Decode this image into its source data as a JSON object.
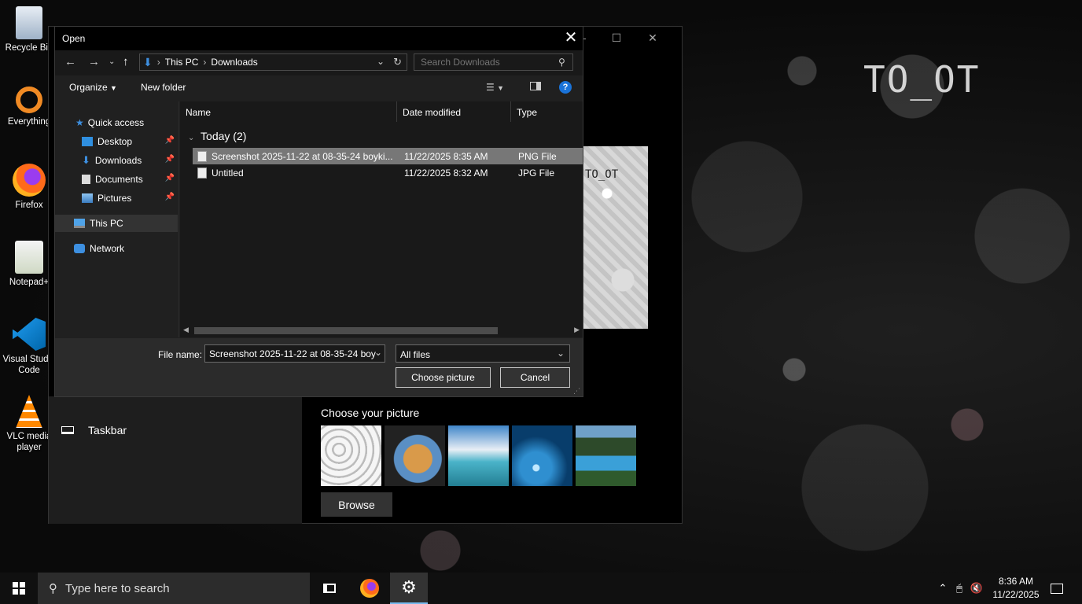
{
  "desktop": {
    "icons": [
      {
        "label": "Recycle Bin",
        "icon": "recycle-bin-icon"
      },
      {
        "label": "Everything",
        "icon": "everything-icon"
      },
      {
        "label": "Firefox",
        "icon": "firefox-icon"
      },
      {
        "label": "Notepad+",
        "icon": "notepad-plus-icon"
      },
      {
        "label": "Visual Studio Code",
        "icon": "vscode-icon"
      },
      {
        "label": "VLC media player",
        "icon": "vlc-icon"
      }
    ],
    "wallpaper_text": "TO_OT"
  },
  "settings_window": {
    "nav_taskbar": "Taskbar",
    "choose_your_picture": "Choose your picture",
    "browse_label": "Browse"
  },
  "dialog": {
    "title": "Open",
    "address": {
      "root": "This PC",
      "current": "Downloads"
    },
    "search_placeholder": "Search Downloads",
    "toolbar": {
      "organize": "Organize",
      "new_folder": "New folder"
    },
    "nav": {
      "quick_access": "Quick access",
      "desktop": "Desktop",
      "downloads": "Downloads",
      "documents": "Documents",
      "pictures": "Pictures",
      "this_pc": "This PC",
      "network": "Network"
    },
    "columns": {
      "name": "Name",
      "date": "Date modified",
      "type": "Type"
    },
    "group": "Today (2)",
    "files": [
      {
        "name": "Screenshot 2025-11-22 at 08-35-24 boyki...",
        "date": "11/22/2025 8:35 AM",
        "type": "PNG File"
      },
      {
        "name": "Untitled",
        "date": "11/22/2025 8:32 AM",
        "type": "JPG File"
      }
    ],
    "file_name_label": "File name:",
    "file_name_value": "Screenshot 2025-11-22 at 08-35-24 boy",
    "file_type": "All files",
    "choose_button": "Choose picture",
    "cancel_button": "Cancel"
  },
  "taskbar": {
    "search_placeholder": "Type here to search",
    "time": "8:36 AM",
    "date": "11/22/2025"
  },
  "colors": {
    "accent": "#76b9ed",
    "selection": "#777777",
    "help": "#1a73d9"
  }
}
